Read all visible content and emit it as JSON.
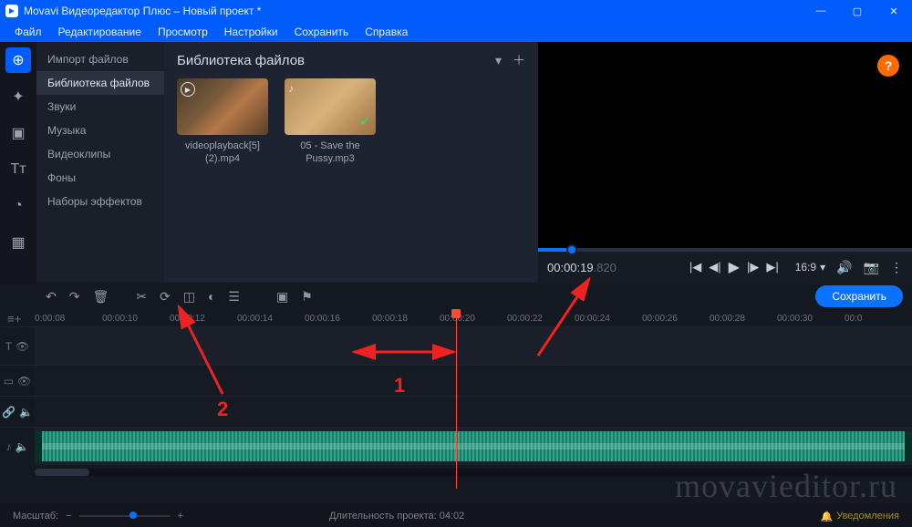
{
  "window": {
    "title": "Movavi Видеоредактор Плюс – Новый проект *",
    "logo_letter": "►"
  },
  "menu": [
    "Файл",
    "Редактирование",
    "Просмотр",
    "Настройки",
    "Сохранить",
    "Справка"
  ],
  "lefttools": [
    {
      "name": "add-media",
      "glyph": "⊕",
      "selected": true
    },
    {
      "name": "filters",
      "glyph": "✦"
    },
    {
      "name": "transitions",
      "glyph": "▣"
    },
    {
      "name": "titles",
      "glyph": "Tᴛ"
    },
    {
      "name": "stickers",
      "glyph": "◔"
    },
    {
      "name": "more",
      "glyph": "▦"
    }
  ],
  "sidebar": {
    "items": [
      "Импорт файлов",
      "Библиотека файлов",
      "Звуки",
      "Музыка",
      "Видеоклипы",
      "Фоны",
      "Наборы эффектов"
    ],
    "selected_index": 1
  },
  "library": {
    "title": "Библиотека файлов",
    "files": [
      {
        "name": "videoplayback[5](2).mp4",
        "kind": "video"
      },
      {
        "name": "05 - Save the Pussy.mp3",
        "kind": "audio",
        "used": true
      }
    ]
  },
  "preview": {
    "timecode": "00:00:19",
    "timecode_ms": ".820",
    "aspect": "16:9"
  },
  "toolbar": {
    "save_label": "Сохранить"
  },
  "timeline": {
    "ruler": [
      "0:00:08",
      "00:00:10",
      "00:00:12",
      "00:00:14",
      "00:00:16",
      "00:00:18",
      "00:00:20",
      "00:00:22",
      "00:00:24",
      "00:00:26",
      "00:00:28",
      "00:00:30",
      "00:0"
    ]
  },
  "status": {
    "zoom_label": "Масштаб:",
    "duration_label": "Длительность проекта:",
    "duration_value": "04:02",
    "notifications": "Уведомления"
  },
  "annotations": {
    "label1": "1",
    "label2": "2"
  },
  "watermark": "movavieditor.ru"
}
